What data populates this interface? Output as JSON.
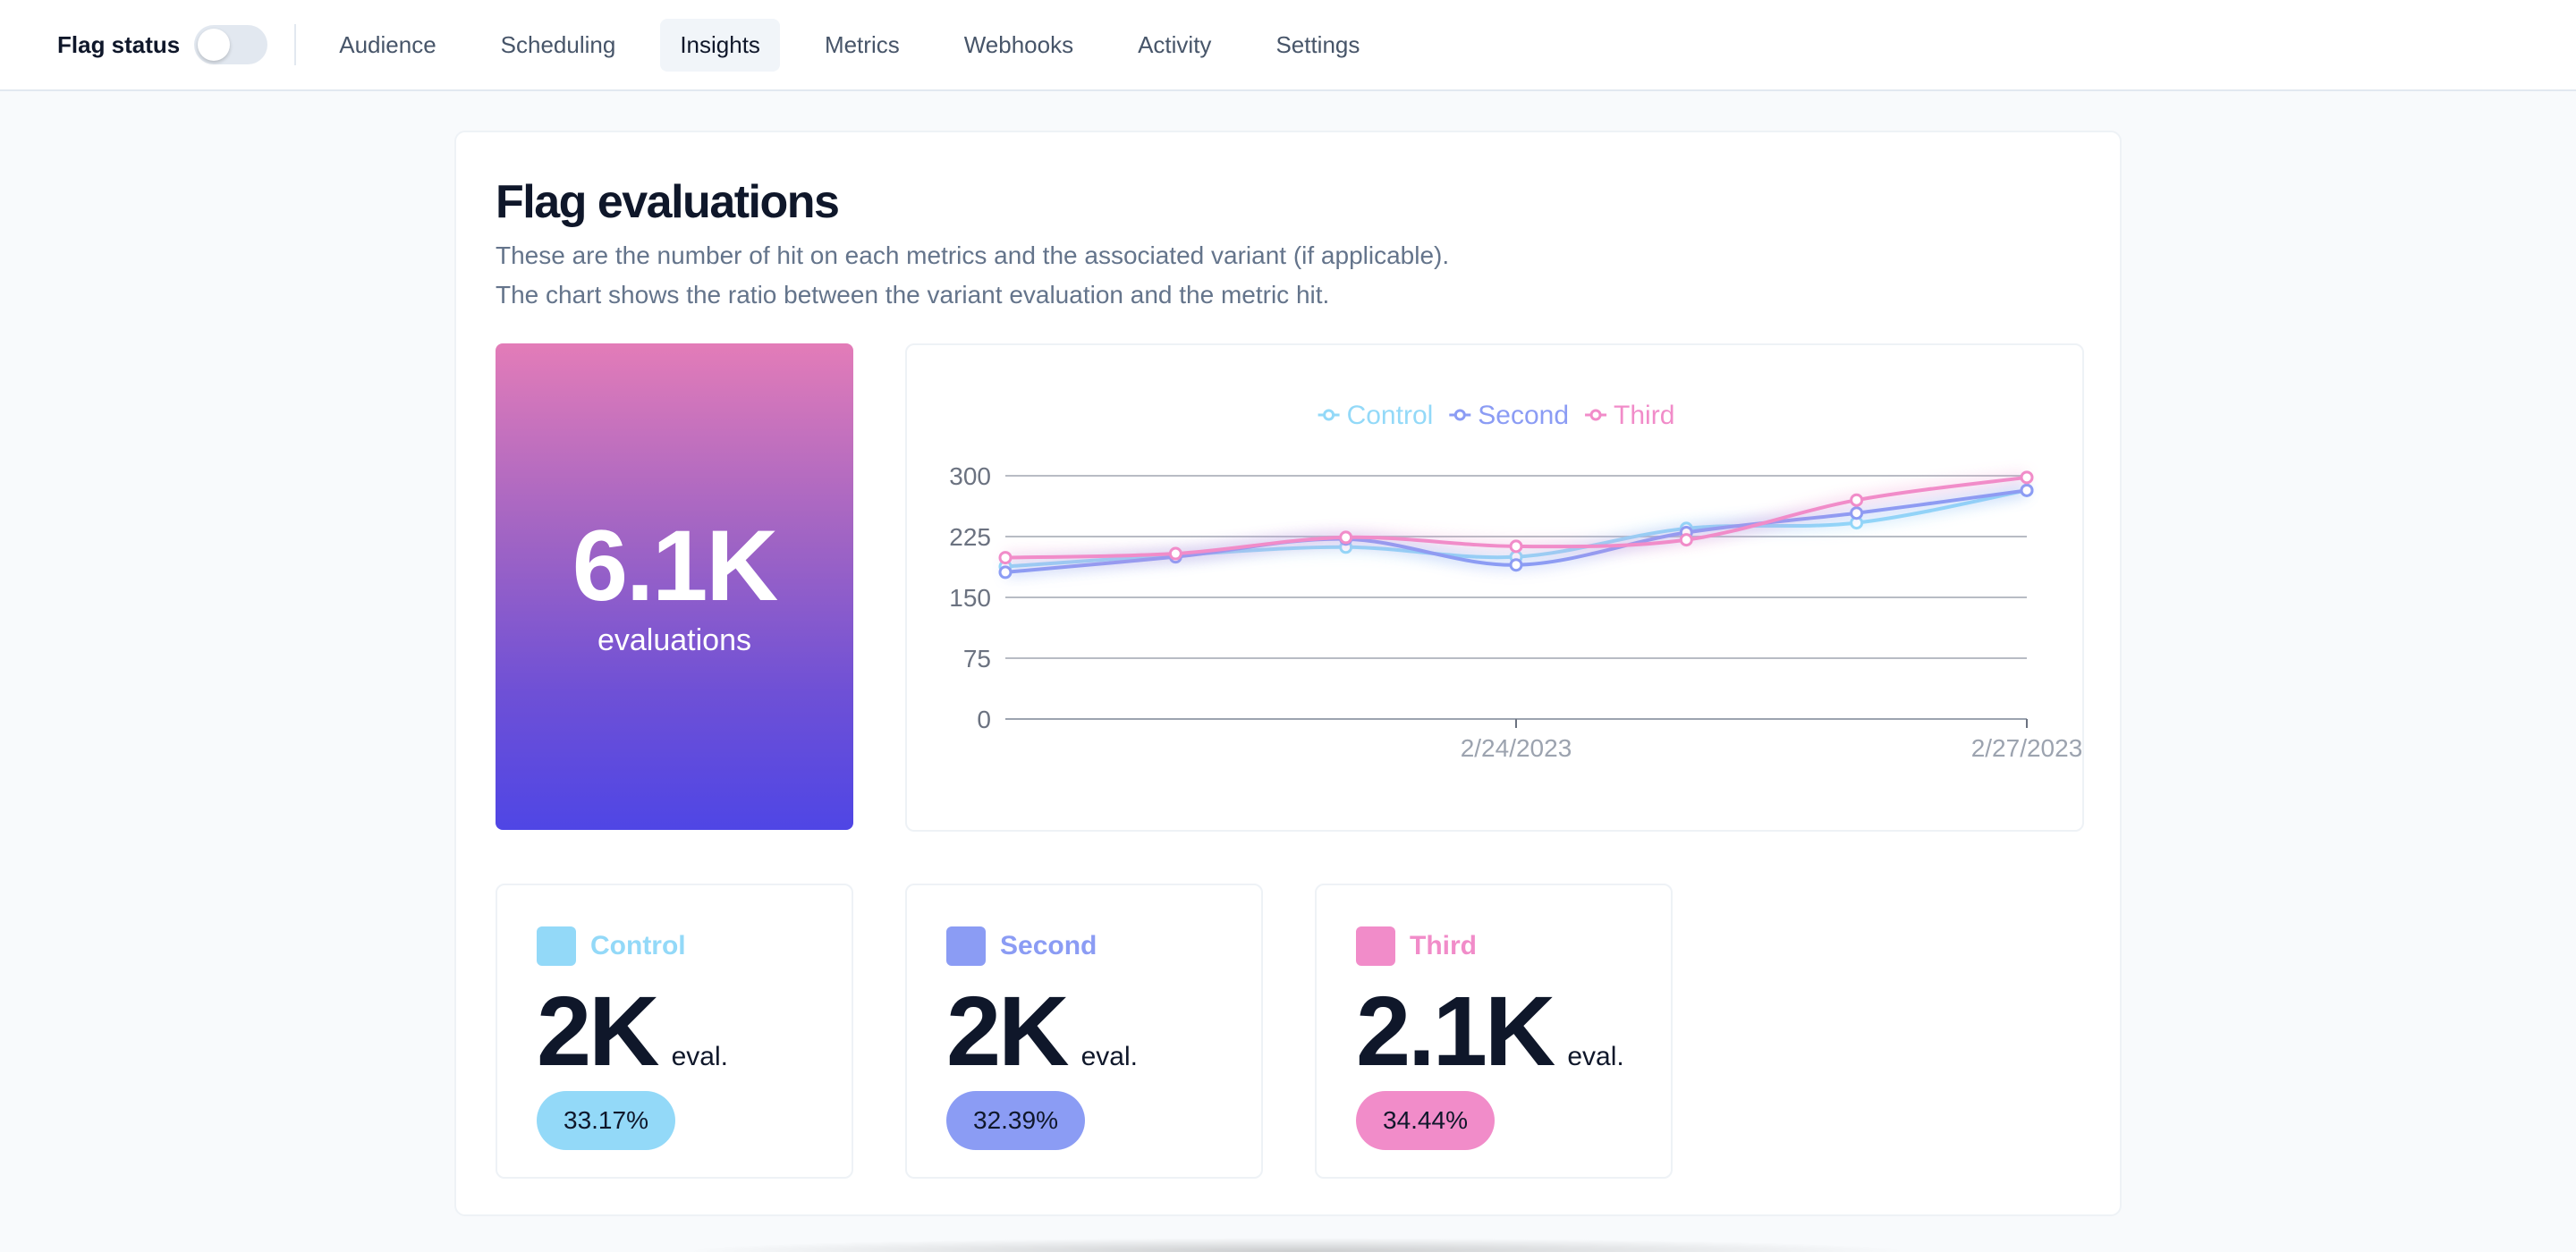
{
  "nav": {
    "flag_status_label": "Flag status",
    "flag_enabled": false,
    "tabs": [
      {
        "label": "Audience",
        "active": false
      },
      {
        "label": "Scheduling",
        "active": false
      },
      {
        "label": "Insights",
        "active": true
      },
      {
        "label": "Metrics",
        "active": false
      },
      {
        "label": "Webhooks",
        "active": false
      },
      {
        "label": "Activity",
        "active": false
      },
      {
        "label": "Settings",
        "active": false
      }
    ]
  },
  "main": {
    "title": "Flag evaluations",
    "description_line1": "These are the number of hit on each metrics and the associated variant (if applicable).",
    "description_line2": "The chart shows the ratio between the variant evaluation and the metric hit.",
    "total": {
      "value": "6.1K",
      "label": "evaluations"
    }
  },
  "variants": [
    {
      "name": "Control",
      "count": "2K",
      "unit": "eval.",
      "percent": "33.17%",
      "color": "#93d9f8"
    },
    {
      "name": "Second",
      "count": "2K",
      "unit": "eval.",
      "percent": "32.39%",
      "color": "#8b9cf4"
    },
    {
      "name": "Third",
      "count": "2.1K",
      "unit": "eval.",
      "percent": "34.44%",
      "color": "#f18cc9"
    }
  ],
  "chart_data": {
    "type": "line",
    "x": [
      "2/21/2023",
      "2/22/2023",
      "2/23/2023",
      "2/24/2023",
      "2/25/2023",
      "2/26/2023",
      "2/27/2023"
    ],
    "x_tick_labels": [
      "2/24/2023",
      "2/27/2023"
    ],
    "ylim": [
      0,
      300
    ],
    "yticks": [
      0,
      75,
      150,
      225,
      300
    ],
    "grid": true,
    "legend_position": "top-center",
    "series": [
      {
        "name": "Control",
        "color": "#93d9f8",
        "values": [
          188,
          202,
          212,
          200,
          235,
          242,
          282
        ]
      },
      {
        "name": "Second",
        "color": "#8b9cf4",
        "values": [
          181,
          200,
          222,
          190,
          230,
          254,
          282
        ]
      },
      {
        "name": "Third",
        "color": "#f18cc9",
        "values": [
          199,
          204,
          224,
          213,
          221,
          270,
          298
        ]
      }
    ]
  }
}
